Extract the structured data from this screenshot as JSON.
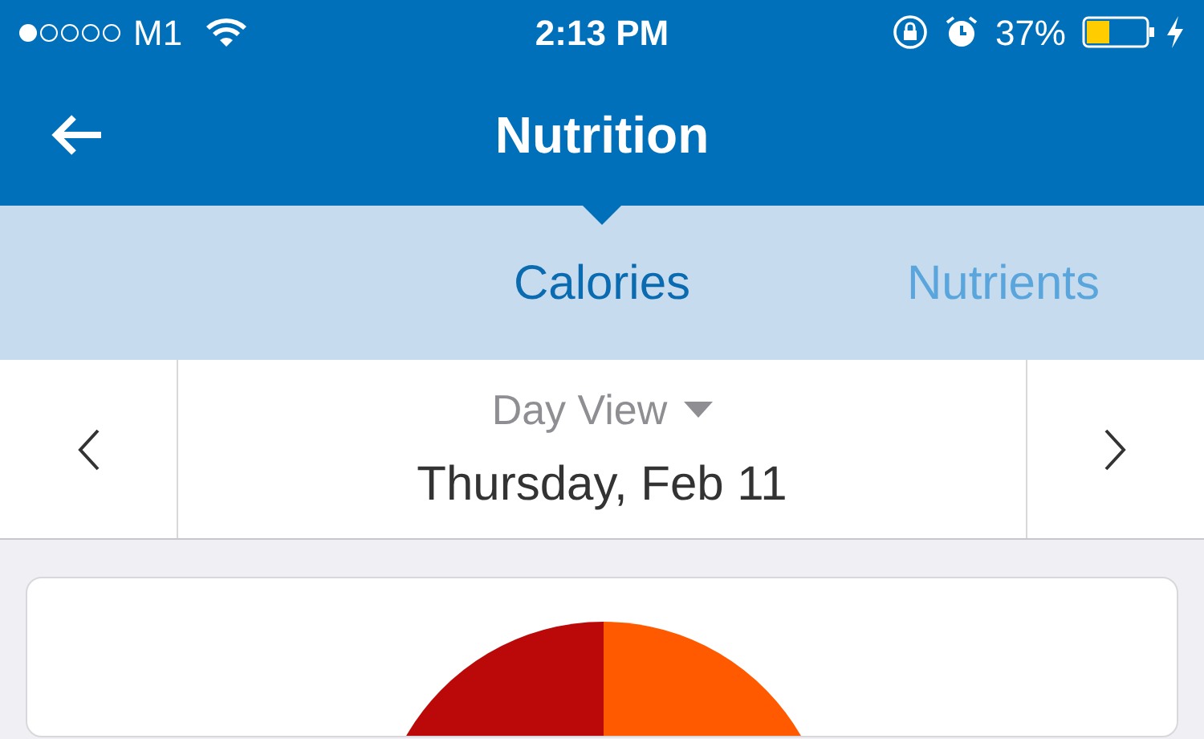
{
  "status_bar": {
    "carrier": "M1",
    "time": "2:13 PM",
    "battery": "37%"
  },
  "nav": {
    "title": "Nutrition"
  },
  "tabs": [
    {
      "label": "Calories",
      "selected": true
    },
    {
      "label": "Nutrients",
      "selected": false
    }
  ],
  "date_picker": {
    "view": "Day View",
    "date": "Thursday, Feb 11"
  }
}
